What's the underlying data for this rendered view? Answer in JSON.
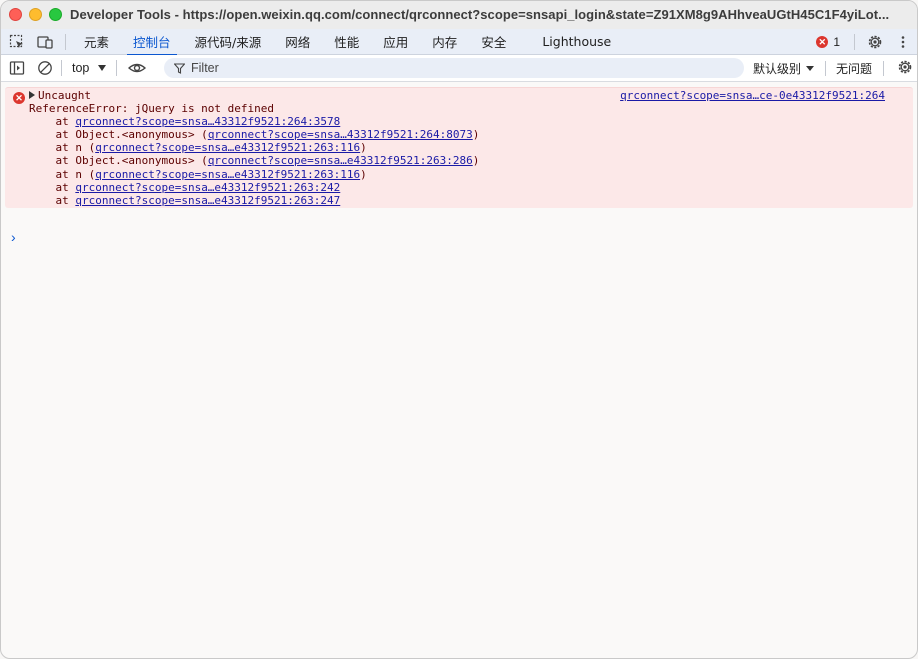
{
  "window": {
    "title": "Developer Tools - https://open.weixin.qq.com/connect/qrconnect?scope=snsapi_login&state=Z91XM8g9AHhveaUGtH45C1F4yiLot..."
  },
  "tabs": [
    {
      "label": "元素"
    },
    {
      "label": "控制台",
      "active": true
    },
    {
      "label": "源代码/来源"
    },
    {
      "label": "网络"
    },
    {
      "label": "性能"
    },
    {
      "label": "应用"
    },
    {
      "label": "内存"
    },
    {
      "label": "安全"
    },
    {
      "label": "Lighthouse"
    }
  ],
  "error_count": "1",
  "toolbar": {
    "context": "top",
    "filter_placeholder": "Filter",
    "levels": "默认级别",
    "issues": "无问题"
  },
  "console": {
    "error": {
      "header": "Uncaught",
      "source": "qrconnect?scope=snsa…ce-0e43312f9521:264",
      "message": "ReferenceError: jQuery is not defined",
      "stack": [
        {
          "prefix": "    at ",
          "link": "qrconnect?scope=snsa…43312f9521:264:3578",
          "suffix": ""
        },
        {
          "prefix": "    at Object.<anonymous> (",
          "link": "qrconnect?scope=snsa…43312f9521:264:8073",
          "suffix": ")"
        },
        {
          "prefix": "    at n (",
          "link": "qrconnect?scope=snsa…e43312f9521:263:116",
          "suffix": ")"
        },
        {
          "prefix": "    at Object.<anonymous> (",
          "link": "qrconnect?scope=snsa…e43312f9521:263:286",
          "suffix": ")"
        },
        {
          "prefix": "    at n (",
          "link": "qrconnect?scope=snsa…e43312f9521:263:116",
          "suffix": ")"
        },
        {
          "prefix": "    at ",
          "link": "qrconnect?scope=snsa…e43312f9521:263:242",
          "suffix": ""
        },
        {
          "prefix": "    at ",
          "link": "qrconnect?scope=snsa…e43312f9521:263:247",
          "suffix": ""
        }
      ]
    },
    "prompt_symbol": "›"
  },
  "colors": {
    "accent": "#0b57d0",
    "error_bg": "#fce8e8",
    "error_text": "#5c0000",
    "link": "#1a1aa6"
  }
}
